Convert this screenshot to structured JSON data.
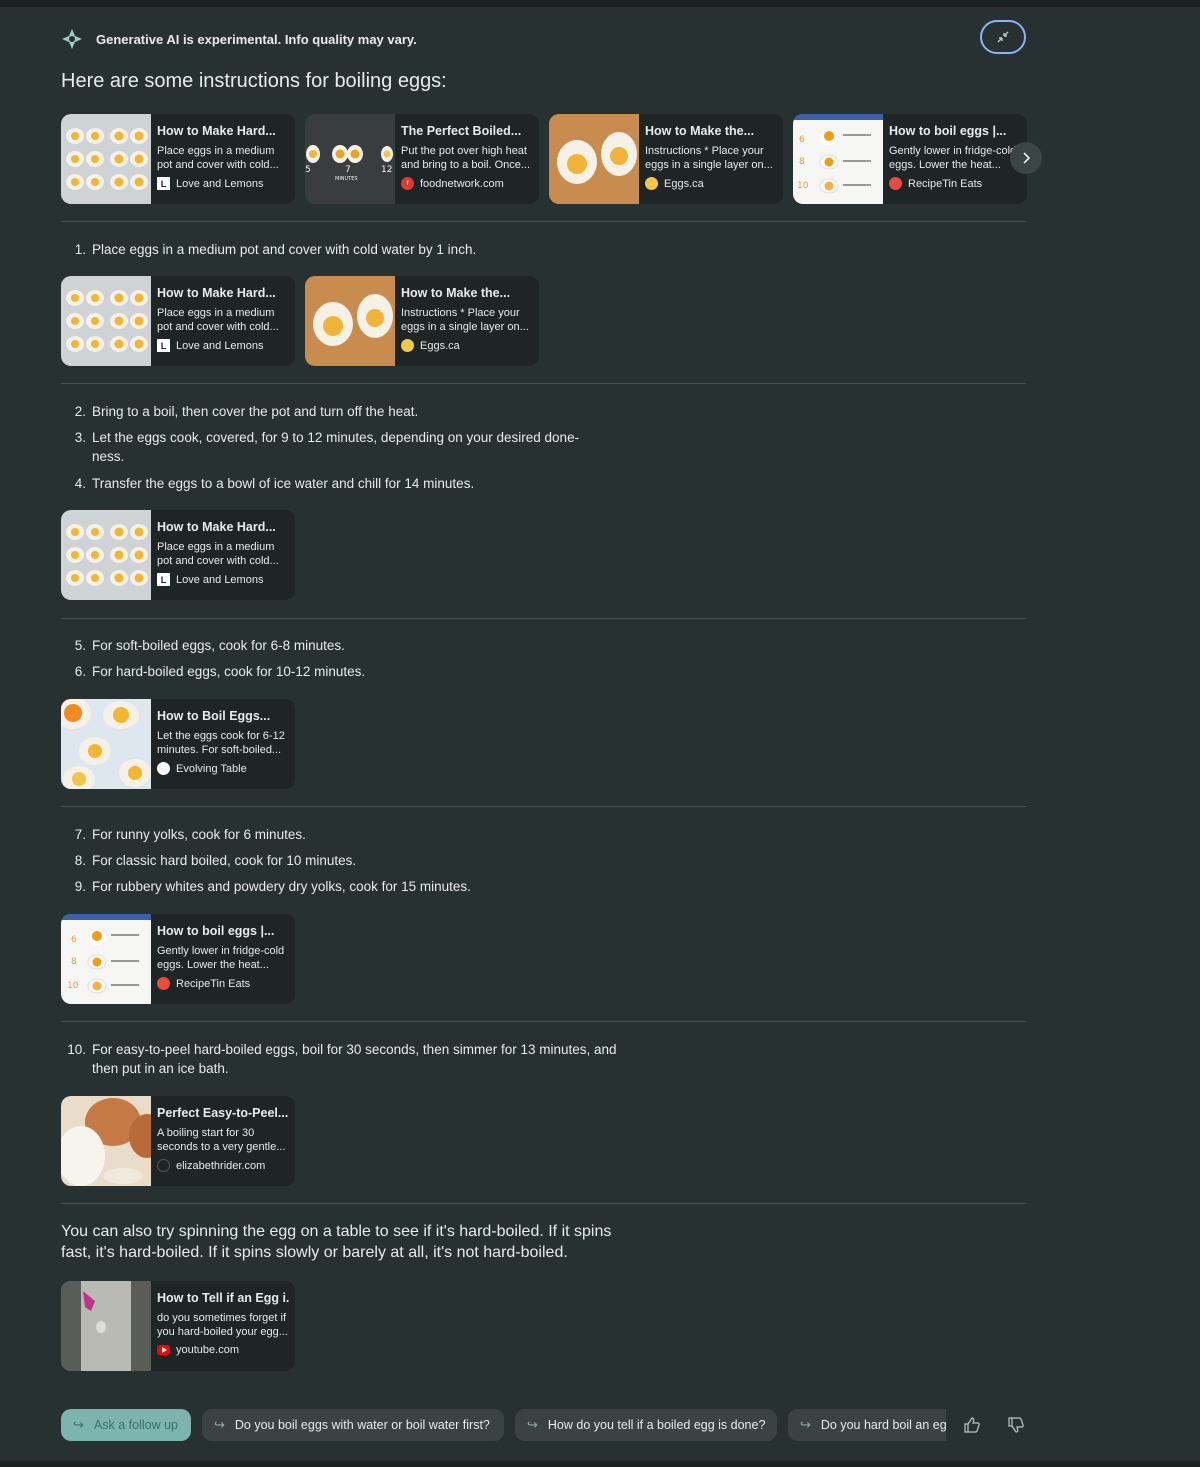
{
  "header": {
    "notice": "Generative AI is experimental. Info quality may vary.",
    "intro": "Here are some instructions for boiling eggs:"
  },
  "top_cards": [
    {
      "title": "How to Make Hard...",
      "snippet": "Place eggs in a medium pot and cover with cold...",
      "source": "Love and Lemons",
      "favicon": "love-and-lemons-icon"
    },
    {
      "title": "The Perfect Boiled...",
      "snippet": "Put the pot over high heat and bring to a boil. Once...",
      "source": "foodnetwork.com",
      "favicon": "food-network-icon"
    },
    {
      "title": "How to Make the...",
      "snippet": "Instructions * Place your eggs in a single layer on...",
      "source": "Eggs.ca",
      "favicon": "eggs-ca-icon"
    },
    {
      "title": "How to boil eggs |...",
      "snippet": "Gently lower in fridge-cold eggs. Lower the heat...",
      "source": "RecipeTin Eats",
      "favicon": "recipetin-icon"
    }
  ],
  "thumb_text": {
    "five": "5",
    "seven": "7",
    "twelve": "12",
    "minutes": "MINUTES",
    "six": "6",
    "eight": "8",
    "ten": "10"
  },
  "steps": [
    {
      "num": "1.",
      "text": "Place eggs in a medium pot and cover with cold water by 1 inch."
    },
    {
      "num": "2.",
      "text": "Bring to a boil, then cover the pot and turn off the heat."
    },
    {
      "num": "3.",
      "text": "Let the eggs cook, covered, for 9 to 12 minutes, depending on your desired done-ness."
    },
    {
      "num": "4.",
      "text": "Transfer the eggs to a bowl of ice water and chill for 14 minutes."
    },
    {
      "num": "5.",
      "text": "For soft-boiled eggs, cook for 6-8 minutes."
    },
    {
      "num": "6.",
      "text": "For hard-boiled eggs, cook for 10-12 minutes."
    },
    {
      "num": "7.",
      "text": "For runny yolks, cook for 6 minutes."
    },
    {
      "num": "8.",
      "text": "For classic hard boiled, cook for 10 minutes."
    },
    {
      "num": "9.",
      "text": "For rubbery whites and powdery dry yolks, cook for 15 minutes."
    },
    {
      "num": "10.",
      "text": "For easy-to-peel hard-boiled eggs, boil for 30 seconds, then simmer for 13 minutes, and then put in an ice bath."
    }
  ],
  "step_cards": {
    "s1a": {
      "title": "How to Make Hard...",
      "snippet": "Place eggs in a medium pot and cover with cold...",
      "source": "Love and Lemons"
    },
    "s1b": {
      "title": "How to Make the...",
      "snippet": "Instructions * Place your eggs in a single layer on...",
      "source": "Eggs.ca"
    },
    "s4": {
      "title": "How to Make Hard...",
      "snippet": "Place eggs in a medium pot and cover with cold...",
      "source": "Love and Lemons"
    },
    "s6": {
      "title": "How to Boil Eggs...",
      "snippet": "Let the eggs cook for 6-12 minutes. For soft-boiled...",
      "source": "Evolving Table"
    },
    "s9": {
      "title": "How to boil eggs |...",
      "snippet": "Gently lower in fridge-cold eggs. Lower the heat...",
      "source": "RecipeTin Eats"
    },
    "s10": {
      "title": "Perfect Easy-to-Peel...",
      "snippet": "A boiling start for 30 seconds to a very gentle...",
      "source": "elizabethrider.com"
    },
    "outro": {
      "title": "How to Tell if an Egg i...",
      "snippet": "do you sometimes forget if you hard-boiled your egg...",
      "source": "youtube.com"
    }
  },
  "outro": "You can also try spinning the egg on a table to see if it's hard-boiled. If it spins fast, it's hard-boiled. If it spins slowly or barely at all, it's not hard-boiled.",
  "followups": {
    "ask": "Ask a follow up",
    "q1": "Do you boil eggs with water or boil water first?",
    "q2": "How do you tell if a boiled egg is done?",
    "q3": "Do you hard boil an eg"
  },
  "colors": {
    "background": "#283132",
    "card": "#1f2424",
    "accent_chip": "#7db4ad",
    "collapse_border": "#8ab4f8"
  }
}
